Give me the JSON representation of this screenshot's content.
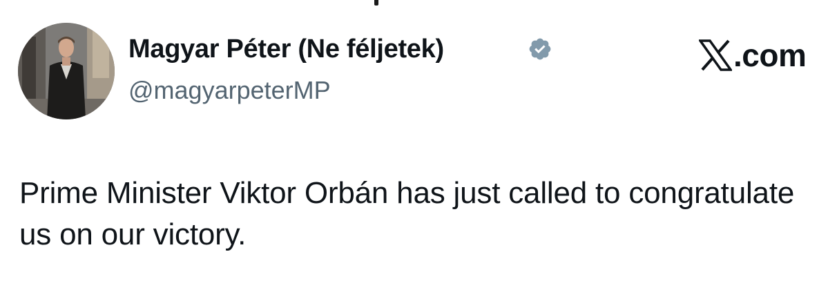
{
  "tweet": {
    "author": {
      "display_name": "Magyar Péter (Ne féljetek)",
      "handle": "@magyarpeterMP",
      "verified": true,
      "avatar_icon": "profile-photo-man-in-dark-coat"
    },
    "source_label": ".com",
    "source_icon": "x-logo-icon",
    "text": "Prime Minister Viktor Orbán has just called to congratulate us on our victory."
  },
  "colors": {
    "text_primary": "#0f1419",
    "text_secondary": "#536471",
    "verified_badge": "#829aab",
    "background": "#ffffff"
  }
}
